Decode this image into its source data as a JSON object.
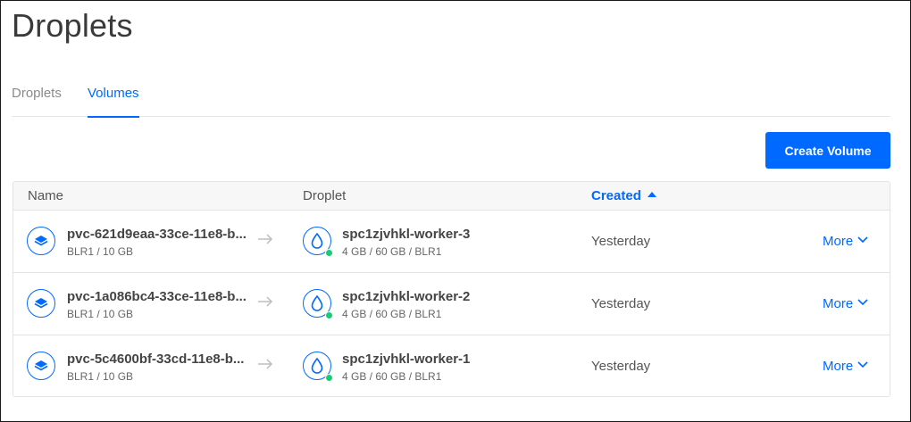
{
  "page": {
    "title": "Droplets"
  },
  "tabs": [
    {
      "label": "Droplets",
      "active": false
    },
    {
      "label": "Volumes",
      "active": true
    }
  ],
  "toolbar": {
    "create_label": "Create Volume"
  },
  "table": {
    "columns": {
      "name": "Name",
      "droplet": "Droplet",
      "created": "Created"
    },
    "sort": {
      "column": "Created",
      "direction": "ascending"
    },
    "rows": [
      {
        "name": "pvc-621d9eaa-33ce-11e8-b...",
        "meta": "BLR1 / 10 GB",
        "droplet": "spc1zjvhkl-worker-3",
        "droplet_meta": "4 GB / 60 GB / BLR1",
        "created": "Yesterday",
        "action": "More"
      },
      {
        "name": "pvc-1a086bc4-33ce-11e8-b...",
        "meta": "BLR1 / 10 GB",
        "droplet": "spc1zjvhkl-worker-2",
        "droplet_meta": "4 GB / 60 GB / BLR1",
        "created": "Yesterday",
        "action": "More"
      },
      {
        "name": "pvc-5c4600bf-33cd-11e8-b...",
        "meta": "BLR1 / 10 GB",
        "droplet": "spc1zjvhkl-worker-1",
        "droplet_meta": "4 GB / 60 GB / BLR1",
        "created": "Yesterday",
        "action": "More"
      }
    ]
  },
  "icons": {
    "volume": "volume-icon",
    "droplet": "droplet-icon",
    "attached": "arrow-right-icon",
    "sort": "caret-up-icon",
    "dropdown": "chevron-down-icon"
  },
  "colors": {
    "accent": "#0069ff",
    "status_active": "#15cd72",
    "muted_text": "#8a8a8a"
  }
}
